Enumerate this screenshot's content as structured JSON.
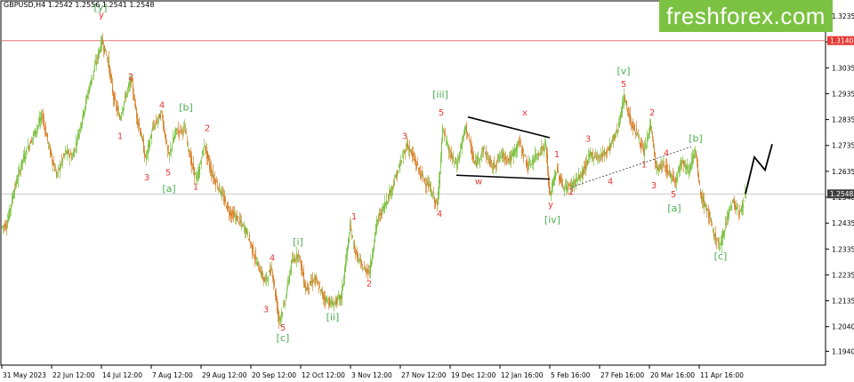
{
  "header": {
    "symbol": "GBPUSD,H4",
    "ohlc": "1.2542 1.2556 1.2541 1.2548"
  },
  "brand": {
    "text": "freshforex.com",
    "color": "#7cc242"
  },
  "colors": {
    "bull": "#7cc242",
    "bear": "#d9822b",
    "wave_red": "#e53935",
    "wave_green": "#4caf50",
    "hline_red": "#e57373",
    "hline_current": "#9e9e9e",
    "price_tag_red": "#e53935",
    "price_tag_current": "#3f3f3f"
  },
  "chart_data": {
    "type": "candlestick",
    "x_tick_labels": [
      "31 May 2023",
      "22 Jun 12:00",
      "14 Jul 12:00",
      "7 Aug 12:00",
      "29 Aug 12:00",
      "20 Sep 12:00",
      "12 Oct 12:00",
      "3 Nov 12:00",
      "27 Nov 12:00",
      "19 Dec 12:00",
      "12 Jan 16:00",
      "5 Feb 16:00",
      "27 Feb 16:00",
      "20 Mar 16:00",
      "11 Apr 16:00"
    ],
    "y_ticks": [
      1.2035,
      1.2135,
      1.2235,
      1.2335,
      1.2435,
      1.2535,
      1.2635,
      1.2735,
      1.2835,
      1.2935,
      1.3035,
      1.3135,
      1.3235,
      1.194
    ],
    "y_tick_labels": [
      "1.2040",
      "1.2135",
      "1.2235",
      "1.2335",
      "1.2435",
      "1.2548",
      "1.2635",
      "1.2735",
      "1.2835",
      "1.2935",
      "1.3035",
      "1.3140",
      "1.3235",
      "1.1940"
    ],
    "ylim": [
      1.189,
      1.329
    ],
    "resistance_level": 1.314,
    "resistance_label": "1.3140",
    "current_price": 1.2548,
    "current_label": "1.2548",
    "price_path": [
      [
        0,
        1.242
      ],
      [
        6,
        1.243
      ],
      [
        14,
        1.256
      ],
      [
        24,
        1.268
      ],
      [
        34,
        1.276
      ],
      [
        46,
        1.285
      ],
      [
        54,
        1.272
      ],
      [
        62,
        1.262
      ],
      [
        72,
        1.271
      ],
      [
        80,
        1.269
      ],
      [
        88,
        1.28
      ],
      [
        98,
        1.295
      ],
      [
        106,
        1.305
      ],
      [
        113,
        1.314
      ],
      [
        120,
        1.306
      ],
      [
        126,
        1.292
      ],
      [
        133,
        1.284
      ],
      [
        140,
        1.293
      ],
      [
        146,
        1.299
      ],
      [
        152,
        1.285
      ],
      [
        158,
        1.276
      ],
      [
        162,
        1.268
      ],
      [
        170,
        1.28
      ],
      [
        180,
        1.286
      ],
      [
        188,
        1.269
      ],
      [
        196,
        1.279
      ],
      [
        206,
        1.28
      ],
      [
        214,
        1.266
      ],
      [
        220,
        1.26
      ],
      [
        228,
        1.274
      ],
      [
        236,
        1.263
      ],
      [
        246,
        1.256
      ],
      [
        256,
        1.248
      ],
      [
        266,
        1.245
      ],
      [
        276,
        1.24
      ],
      [
        286,
        1.229
      ],
      [
        296,
        1.221
      ],
      [
        304,
        1.226
      ],
      [
        312,
        1.206
      ],
      [
        318,
        1.212
      ],
      [
        326,
        1.228
      ],
      [
        334,
        1.232
      ],
      [
        342,
        1.218
      ],
      [
        352,
        1.222
      ],
      [
        362,
        1.215
      ],
      [
        372,
        1.212
      ],
      [
        382,
        1.215
      ],
      [
        392,
        1.242
      ],
      [
        398,
        1.232
      ],
      [
        406,
        1.226
      ],
      [
        414,
        1.225
      ],
      [
        422,
        1.244
      ],
      [
        430,
        1.25
      ],
      [
        440,
        1.258
      ],
      [
        448,
        1.266
      ],
      [
        456,
        1.274
      ],
      [
        464,
        1.268
      ],
      [
        472,
        1.262
      ],
      [
        480,
        1.258
      ],
      [
        490,
        1.25
      ],
      [
        496,
        1.28
      ],
      [
        504,
        1.27
      ],
      [
        512,
        1.266
      ],
      [
        522,
        1.281
      ],
      [
        532,
        1.266
      ],
      [
        542,
        1.272
      ],
      [
        552,
        1.265
      ],
      [
        562,
        1.27
      ],
      [
        572,
        1.268
      ],
      [
        582,
        1.275
      ],
      [
        592,
        1.265
      ],
      [
        602,
        1.27
      ],
      [
        612,
        1.274
      ],
      [
        616,
        1.254
      ],
      [
        624,
        1.264
      ],
      [
        632,
        1.257
      ],
      [
        640,
        1.258
      ],
      [
        652,
        1.262
      ],
      [
        662,
        1.27
      ],
      [
        672,
        1.269
      ],
      [
        682,
        1.272
      ],
      [
        692,
        1.279
      ],
      [
        700,
        1.292
      ],
      [
        708,
        1.282
      ],
      [
        716,
        1.277
      ],
      [
        722,
        1.27
      ],
      [
        730,
        1.282
      ],
      [
        736,
        1.264
      ],
      [
        744,
        1.266
      ],
      [
        752,
        1.262
      ],
      [
        758,
        1.26
      ],
      [
        764,
        1.268
      ],
      [
        772,
        1.264
      ],
      [
        780,
        1.271
      ],
      [
        786,
        1.254
      ],
      [
        794,
        1.248
      ],
      [
        800,
        1.24
      ],
      [
        808,
        1.234
      ],
      [
        814,
        1.244
      ],
      [
        822,
        1.252
      ],
      [
        830,
        1.247
      ],
      [
        836,
        1.2548
      ]
    ],
    "forecast_path": [
      [
        836,
        1.2548
      ],
      [
        846,
        1.269
      ],
      [
        858,
        1.264
      ],
      [
        866,
        1.274
      ]
    ],
    "triangle_upper": [
      [
        524,
        1.2845
      ],
      [
        616,
        1.2765
      ]
    ],
    "triangle_lower": [
      [
        511,
        1.262
      ],
      [
        616,
        1.2605
      ]
    ],
    "dotted_trendline": [
      [
        641,
        1.2575
      ],
      [
        775,
        1.273
      ]
    ],
    "wave_labels": [
      {
        "text": "[y]",
        "x": 111,
        "y": 1.3255,
        "color": "green"
      },
      {
        "text": "y",
        "x": 112,
        "y": 1.3228,
        "color": "red"
      },
      {
        "text": "2",
        "x": 145,
        "y": 1.299,
        "color": "red"
      },
      {
        "text": "1",
        "x": 133,
        "y": 1.276,
        "color": "red"
      },
      {
        "text": "4",
        "x": 180,
        "y": 1.288,
        "color": "red"
      },
      {
        "text": "[b]",
        "x": 207,
        "y": 1.287,
        "color": "green"
      },
      {
        "text": "2",
        "x": 231,
        "y": 1.279,
        "color": "red"
      },
      {
        "text": "3",
        "x": 163,
        "y": 1.26,
        "color": "red"
      },
      {
        "text": "5",
        "x": 187,
        "y": 1.262,
        "color": "red"
      },
      {
        "text": "[a]",
        "x": 188,
        "y": 1.2555,
        "color": "green"
      },
      {
        "text": "1",
        "x": 218,
        "y": 1.2565,
        "color": "red"
      },
      {
        "text": "4",
        "x": 304,
        "y": 1.229,
        "color": "red"
      },
      {
        "text": "3",
        "x": 297,
        "y": 1.209,
        "color": "red"
      },
      {
        "text": "5",
        "x": 316,
        "y": 1.202,
        "color": "red"
      },
      {
        "text": "[c]",
        "x": 316,
        "y": 1.198,
        "color": "green"
      },
      {
        "text": "[i]",
        "x": 333,
        "y": 1.235,
        "color": "green"
      },
      {
        "text": "[ii]",
        "x": 372,
        "y": 1.206,
        "color": "green"
      },
      {
        "text": "2",
        "x": 413,
        "y": 1.219,
        "color": "red"
      },
      {
        "text": "1",
        "x": 396,
        "y": 1.245,
        "color": "red"
      },
      {
        "text": "3",
        "x": 453,
        "y": 1.276,
        "color": "red"
      },
      {
        "text": "4",
        "x": 492,
        "y": 1.246,
        "color": "red"
      },
      {
        "text": "[iii]",
        "x": 493,
        "y": 1.292,
        "color": "green"
      },
      {
        "text": "5",
        "x": 494,
        "y": 1.285,
        "color": "red"
      },
      {
        "text": "x",
        "x": 588,
        "y": 1.285,
        "color": "red"
      },
      {
        "text": "w",
        "x": 536,
        "y": 1.2585,
        "color": "red"
      },
      {
        "text": "1",
        "x": 624,
        "y": 1.269,
        "color": "red"
      },
      {
        "text": "y",
        "x": 617,
        "y": 1.2495,
        "color": "red"
      },
      {
        "text": "[iv]",
        "x": 619,
        "y": 1.2435,
        "color": "green"
      },
      {
        "text": "2",
        "x": 640,
        "y": 1.2545,
        "color": "red"
      },
      {
        "text": "3",
        "x": 659,
        "y": 1.275,
        "color": "red"
      },
      {
        "text": "4",
        "x": 684,
        "y": 1.2585,
        "color": "red"
      },
      {
        "text": "[v]",
        "x": 699,
        "y": 1.301,
        "color": "green"
      },
      {
        "text": "5",
        "x": 699,
        "y": 1.296,
        "color": "red"
      },
      {
        "text": "2",
        "x": 731,
        "y": 1.285,
        "color": "red"
      },
      {
        "text": "1",
        "x": 722,
        "y": 1.265,
        "color": "red"
      },
      {
        "text": "4",
        "x": 747,
        "y": 1.2695,
        "color": "red"
      },
      {
        "text": "3",
        "x": 733,
        "y": 1.257,
        "color": "red"
      },
      {
        "text": "5",
        "x": 755,
        "y": 1.2535,
        "color": "red"
      },
      {
        "text": "[a]",
        "x": 756,
        "y": 1.248,
        "color": "green"
      },
      {
        "text": "[b]",
        "x": 780,
        "y": 1.275,
        "color": "green"
      },
      {
        "text": "[c]",
        "x": 808,
        "y": 1.2295,
        "color": "green"
      }
    ]
  }
}
